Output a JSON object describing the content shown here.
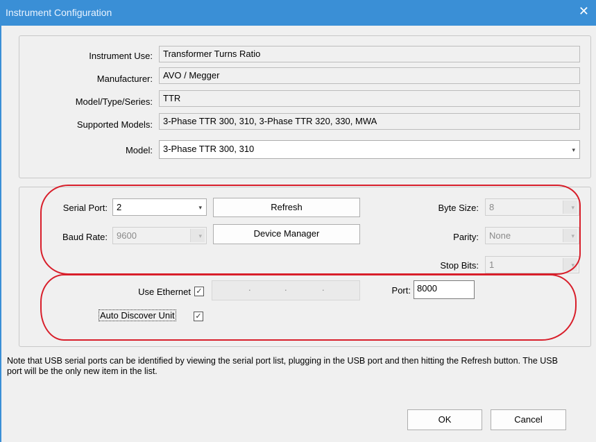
{
  "window": {
    "title": "Instrument Configuration",
    "close_glyph": "✕"
  },
  "instrument": {
    "use_label": "Instrument Use:",
    "use_value": "Transformer Turns Ratio",
    "manufacturer_label": "Manufacturer:",
    "manufacturer_value": "AVO / Megger",
    "model_type_label": "Model/Type/Series:",
    "model_type_value": "TTR",
    "supported_label": "Supported Models:",
    "supported_value": "3-Phase TTR 300, 310, 3-Phase TTR 320, 330, MWA",
    "model_label": "Model:",
    "model_value": "3-Phase TTR 300, 310"
  },
  "serial": {
    "port_label": "Serial Port:",
    "port_value": "2",
    "baud_label": "Baud Rate:",
    "baud_value": "9600",
    "refresh_button": "Refresh",
    "device_manager_button": "Device Manager",
    "byte_size_label": "Byte Size:",
    "byte_size_value": "8",
    "parity_label": "Parity:",
    "parity_value": "None",
    "stop_bits_label": "Stop Bits:",
    "stop_bits_value": "1"
  },
  "ethernet": {
    "use_label": "Use Ethernet",
    "use_checked": "✓",
    "ip_placeholder_dot": ".",
    "port_label": "Port:",
    "port_value": "8000",
    "auto_label": "Auto Discover Unit",
    "auto_checked": "✓"
  },
  "note": "Note that USB serial ports can be identified by viewing the serial port list, plugging in the USB port and then hitting the Refresh button.  The USB port will be the only new item in the list.",
  "buttons": {
    "ok": "OK",
    "cancel": "Cancel"
  },
  "icons": {
    "dropdown": "▾"
  },
  "colors": {
    "titlebar": "#3a8fd6",
    "annotation_red": "#d81e2a"
  }
}
